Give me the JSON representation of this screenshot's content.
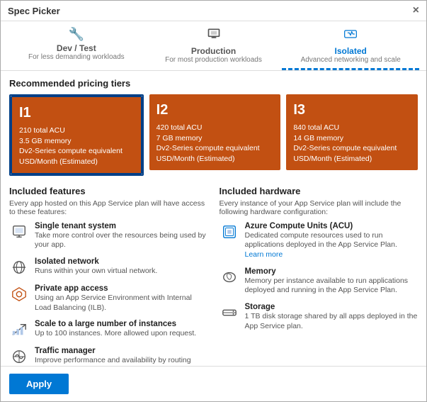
{
  "window": {
    "title": "Spec Picker",
    "close_label": "×"
  },
  "tabs": [
    {
      "id": "dev-test",
      "icon": "🔧",
      "title": "Dev / Test",
      "subtitle": "For less demanding workloads",
      "active": false
    },
    {
      "id": "production",
      "icon": "🖥",
      "title": "Production",
      "subtitle": "For most production workloads",
      "active": false
    },
    {
      "id": "isolated",
      "icon": "💾",
      "title": "Isolated",
      "subtitle": "Advanced networking and scale",
      "active": true
    }
  ],
  "recommended_label": "Recommended pricing tiers",
  "tiers": [
    {
      "id": "I1",
      "label": "I1",
      "acu": "210 total ACU",
      "memory": "3.5 GB memory",
      "compute": "Dv2-Series compute equivalent",
      "price": "USD/Month (Estimated)",
      "selected": true
    },
    {
      "id": "I2",
      "label": "I2",
      "acu": "420 total ACU",
      "memory": "7 GB memory",
      "compute": "Dv2-Series compute equivalent",
      "price": "USD/Month (Estimated)",
      "selected": false
    },
    {
      "id": "I3",
      "label": "I3",
      "acu": "840 total ACU",
      "memory": "14 GB memory",
      "compute": "Dv2-Series compute equivalent",
      "price": "USD/Month (Estimated)",
      "selected": false
    }
  ],
  "included_features": {
    "title": "Included features",
    "subtitle": "Every app hosted on this App Service plan will have access to these features:",
    "items": [
      {
        "name": "Single tenant system",
        "desc": "Take more control over the resources being used by your app."
      },
      {
        "name": "Isolated network",
        "desc": "Runs within your own virtual network."
      },
      {
        "name": "Private app access",
        "desc": "Using an App Service Environment with Internal Load Balancing (ILB)."
      },
      {
        "name": "Scale to a large number of instances",
        "desc": "Up to 100 instances. More allowed upon request."
      },
      {
        "name": "Traffic manager",
        "desc": "Improve performance and availability by routing traffic between multiple instances of your app."
      }
    ]
  },
  "included_hardware": {
    "title": "Included hardware",
    "subtitle": "Every instance of your App Service plan will include the following hardware configuration:",
    "items": [
      {
        "name": "Azure Compute Units (ACU)",
        "desc": "Dedicated compute resources used to run applications deployed in the App Service Plan.",
        "link": "Learn more"
      },
      {
        "name": "Memory",
        "desc": "Memory per instance available to run applications deployed and running in the App Service Plan."
      },
      {
        "name": "Storage",
        "desc": "1 TB disk storage shared by all apps deployed in the App Service plan."
      }
    ]
  },
  "footer": {
    "apply_label": "Apply"
  }
}
